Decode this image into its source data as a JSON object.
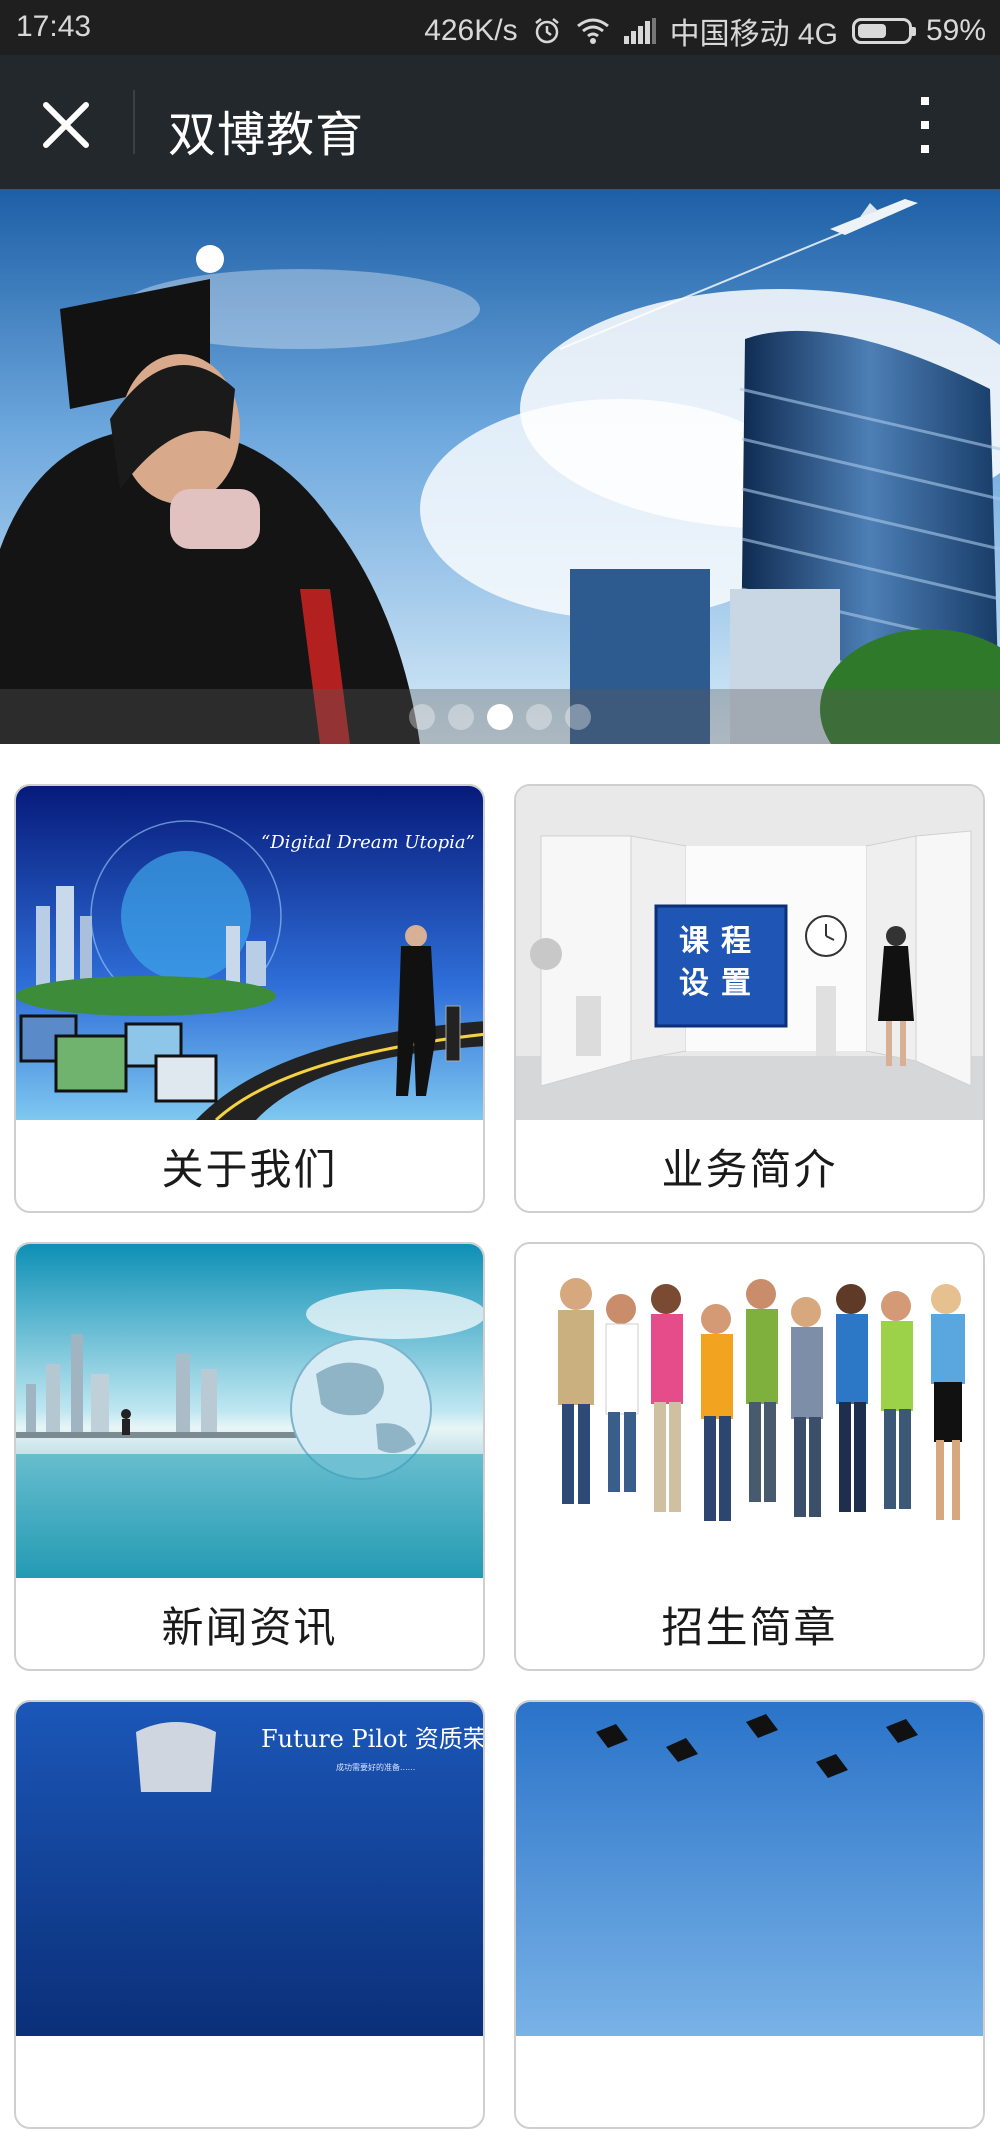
{
  "status_bar": {
    "time": "17:43",
    "speed": "426K/s",
    "carrier": "中国移动 4G",
    "battery_percent": "59%",
    "battery_level": 0.59
  },
  "app_bar": {
    "title": "双博教育"
  },
  "banner": {
    "slide_count": 5,
    "active_slide": 3
  },
  "cards": [
    {
      "label": "关于我们",
      "image_text": "“Digital Dream Utopia”"
    },
    {
      "label": "业务简介",
      "image_text": "课程设置"
    },
    {
      "label": "新闻资讯"
    },
    {
      "label": "招生简章"
    },
    {
      "label": "",
      "image_text": "Future Pilot 资质荣誉"
    },
    {
      "label": ""
    }
  ],
  "colors": {
    "status_bar_bg": "#1f1f1f",
    "app_bar_bg": "#23282c",
    "card_border": "#cfcfcf"
  }
}
